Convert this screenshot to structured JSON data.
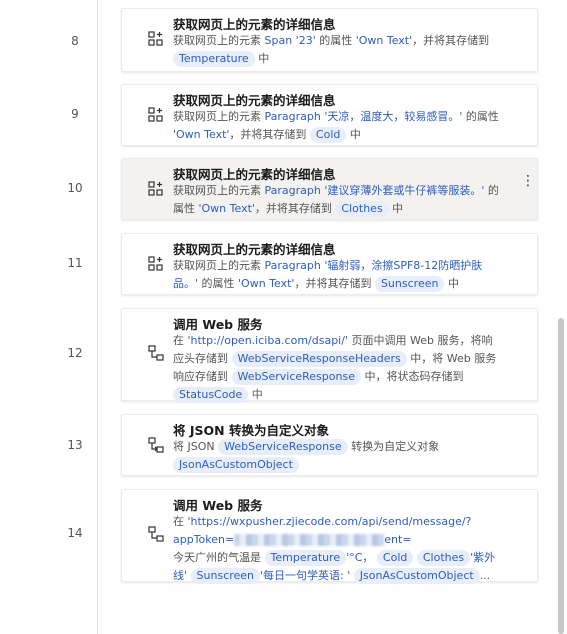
{
  "steps": [
    {
      "num": "8",
      "title": "获取网页上的元素的详细信息",
      "line1_a": "获取网页上的元素 ",
      "line1_lit": "Span '23'",
      "line1_b": " 的属性 ",
      "line1_lit2": "'Own Text'",
      "line1_c": "，并将其存储到",
      "var": "Temperature",
      "tail": "中"
    },
    {
      "num": "9",
      "title": "获取网页上的元素的详细信息",
      "line1_a": "获取网页上的元素 ",
      "line1_lit": "Paragraph '天凉，温度大，较易感冒。'",
      "line1_b": " 的属性 ",
      "line1_lit2": "'Own Text'",
      "line1_c": "，并将其存储到",
      "var": "Cold",
      "tail": "中"
    },
    {
      "num": "10",
      "title": "获取网页上的元素的详细信息",
      "line1_a": "获取网页上的元素 ",
      "line1_lit": "Paragraph '建议穿薄外套或牛仔裤等服装。'",
      "line1_b": " 的属性 ",
      "line1_lit2": "'Own Text'",
      "line1_c": "，并将其存储到",
      "var": "Clothes",
      "tail": "中",
      "more_icon": "⋮"
    },
    {
      "num": "11",
      "title": "获取网页上的元素的详细信息",
      "line1_a": "获取网页上的元素 ",
      "line1_lit": "Paragraph '辐射弱，涂擦SPF8-12防晒护肤品。'",
      "line1_b": " 的属性 ",
      "line1_lit2": "'Own Text'",
      "line1_c": "，并将其存储到",
      "var": "Sunscreen",
      "tail": "中"
    },
    {
      "num": "12",
      "title": "调用 Web 服务",
      "a": "在 ",
      "url": "'http://open.iciba.com/dsapi/'",
      "b": " 页面中调用 Web 服务，将响应头存储到",
      "var1": "WebServiceResponseHeaders",
      "c": "中，将 Web 服务响应存储到",
      "var2": "WebServiceResponse",
      "d": "中，将状态码存储到",
      "var3": "StatusCode",
      "tail": "中"
    },
    {
      "num": "13",
      "title": "将 JSON 转换为自定义对象",
      "a": "将 JSON",
      "var1": "WebServiceResponse",
      "b": "转换为自定义对象",
      "var2": "JsonAsCustomObject"
    },
    {
      "num": "14",
      "title": "调用 Web 服务",
      "a": "在 ",
      "url1": "'https://wxpusher.zjiecode.com/api/send/message/?",
      "url2": "appToken=",
      "url3": "ent=",
      "b": "今天广州的气温是",
      "var1": "Temperature",
      "c": "'°C，",
      "var2": "Cold",
      "var3": "Clothes",
      "d": "'紫外线'",
      "var4": "Sunscreen",
      "e": "'每日一句学英语: '",
      "var5": "JsonAsCustomObject",
      "ellipsis": "..."
    }
  ]
}
